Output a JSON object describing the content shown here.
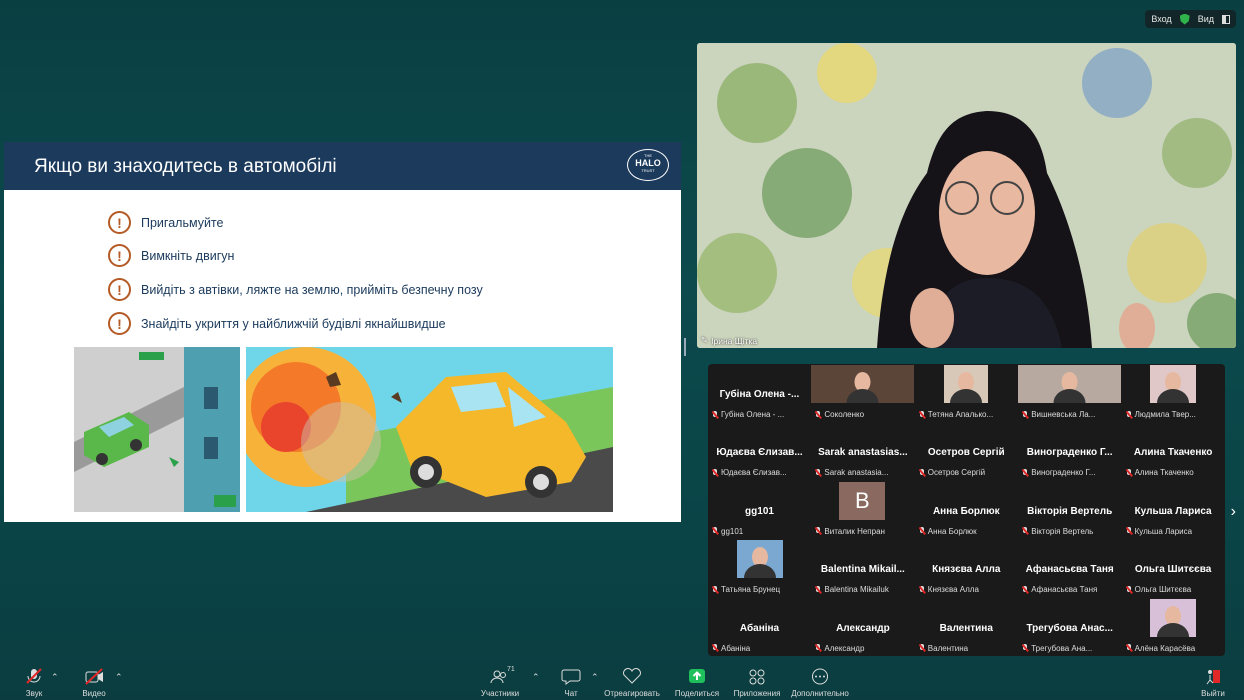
{
  "topbar": {
    "enter": "Вход",
    "view": "Вид"
  },
  "slide": {
    "title": "Якщо ви знаходитесь в автомобілі",
    "logo_small": "THE",
    "logo": "HALO",
    "logo_sub": "TRUST",
    "bullets": [
      "Пригальмуйте",
      "Вимкніть двигун",
      "Вийдіть з автівки, ляжте на землю, прийміть безпечну позу",
      "Знайдіть укриття у найближчій будівлі якнайшвидше"
    ]
  },
  "main_video": {
    "name": "Ірина Щітка"
  },
  "participants": [
    {
      "big": "Губіна Олена -...",
      "small": "Губіна Олена - ..."
    },
    {
      "big": "",
      "small": "Соколенко"
    },
    {
      "big": "",
      "small": "Тетяна Апалько..."
    },
    {
      "big": "",
      "small": "Вишневська Ла..."
    },
    {
      "big": "",
      "small": "Людмила Твер..."
    },
    {
      "big": "Юдаєва Єлизав...",
      "small": "Юдаєва Єлизав..."
    },
    {
      "big": "Sarak anastasias...",
      "small": "Sarak anastasia..."
    },
    {
      "big": "Осетров Сергій",
      "small": "Осетров Сергій"
    },
    {
      "big": "Винограденко Г...",
      "small": "Винограденко Г..."
    },
    {
      "big": "Алина Ткаченко",
      "small": "Алина Ткаченко"
    },
    {
      "big": "gg101",
      "small": "gg101"
    },
    {
      "big": "B",
      "small": "Виталик Непран"
    },
    {
      "big": "Анна Борлюк",
      "small": "Анна Борлюк"
    },
    {
      "big": "Вікторія Вертель",
      "small": "Вікторія Вертель"
    },
    {
      "big": "Кульша Лариса",
      "small": "Кульша Лариса"
    },
    {
      "big": "",
      "small": "Татьяна Брунец"
    },
    {
      "big": "Balentina Mikail...",
      "small": "Balentina Mikailuk"
    },
    {
      "big": "Князєва Алла",
      "small": "Князєва Алла"
    },
    {
      "big": "Афанасьєва Таня",
      "small": "Афанасьєва Таня"
    },
    {
      "big": "Ольга Шитєєва",
      "small": "Ольга Шитєєва"
    },
    {
      "big": "Абаніна",
      "small": "Абаніна"
    },
    {
      "big": "Александр",
      "small": "Александр"
    },
    {
      "big": "Валентина",
      "small": "Валентина"
    },
    {
      "big": "Трегубова Анас...",
      "small": "Трегубова Ана..."
    },
    {
      "big": "",
      "small": "Алёна Карасёва"
    }
  ],
  "toolbar": {
    "audio": "Звук",
    "video": "Видео",
    "participants": "Участники",
    "participants_count": "71",
    "chat": "Чат",
    "react": "Отреагировать",
    "share": "Поделиться",
    "apps": "Приложения",
    "more": "Дополнительно",
    "leave": "Выйти"
  },
  "colors": {
    "share_green": "#1fbf5c",
    "leave_red": "#e02828",
    "slide_header": "#1b3a5c",
    "accent_orange": "#b45a24"
  }
}
